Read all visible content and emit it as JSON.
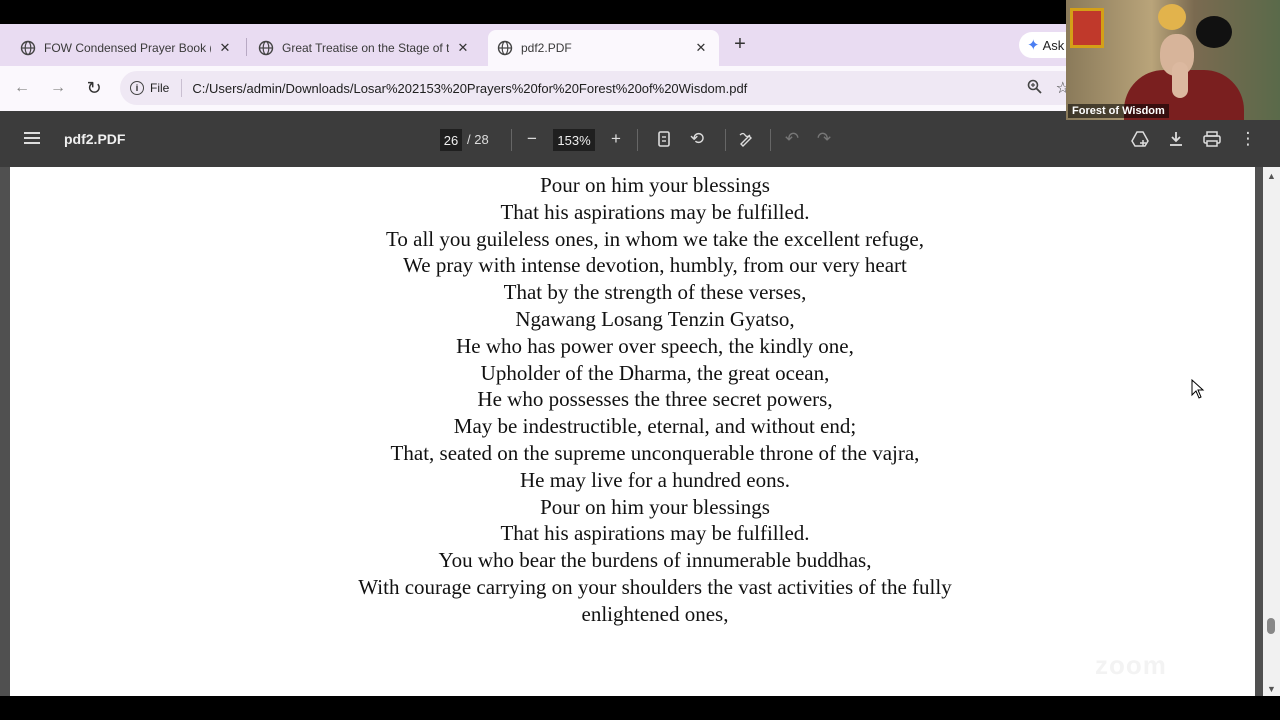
{
  "tabs": [
    {
      "title": "FOW Condensed Prayer Book (I",
      "active": false
    },
    {
      "title": "Great Treatise on the Stage of th",
      "active": false
    },
    {
      "title": "pdf2.PDF",
      "active": true
    }
  ],
  "ask_button": {
    "label": "Ask"
  },
  "address_bar": {
    "scheme_label": "File",
    "url": "C:/Users/admin/Downloads/Losar%202153%20Prayers%20for%20Forest%20of%20Wisdom.pdf"
  },
  "pdf_toolbar": {
    "title": "pdf2.PDF",
    "current_page": "26",
    "total_pages": "/ 28",
    "zoom": "153%"
  },
  "document": {
    "lines": [
      "Pour on him your blessings",
      "That his aspirations may be fulfilled.",
      "To all you guileless ones, in whom we take the excellent refuge,",
      "We pray with intense devotion, humbly, from our very heart",
      "That by the strength of these verses,",
      "Ngawang Losang Tenzin Gyatso,",
      "He who has power over speech, the kindly one,",
      "Upholder of  the Dharma, the great ocean,",
      "He who possesses the three secret powers,",
      "May be indestructible, eternal, and without end;",
      "That, seated on the supreme unconquerable throne of the vajra,",
      "He may live for a hundred eons.",
      "Pour on him your blessings",
      "That his aspirations may be  fulfilled.",
      "You who bear the burdens of innumerable buddhas,",
      "With courage carrying on your shoulders the vast activities of the fully",
      "enlightened ones,"
    ]
  },
  "video": {
    "participant_name": "Forest of Wisdom"
  },
  "watermark": {
    "text": "zoom"
  },
  "colors": {
    "tabbar_bg": "#e9dcf2",
    "toolbar_bg": "#3c3c3c",
    "viewer_bg": "#505050"
  }
}
